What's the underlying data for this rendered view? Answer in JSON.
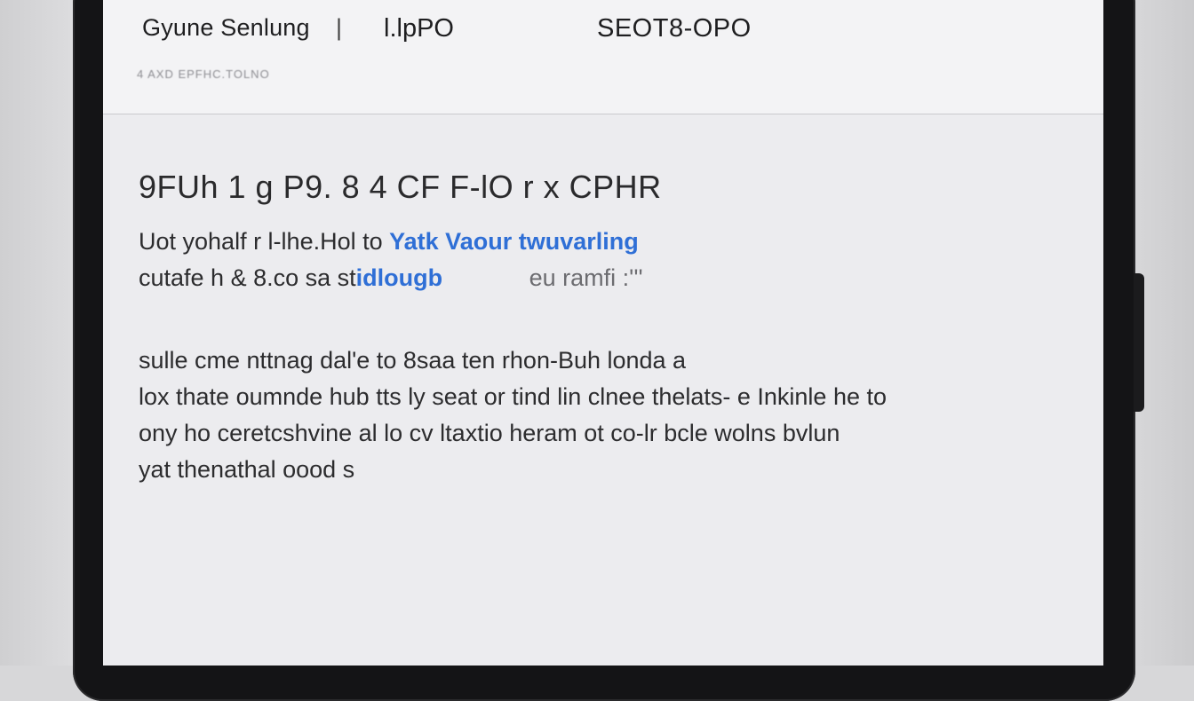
{
  "header": {
    "title": "Gyune Senlung",
    "separator": "|",
    "model": "l.lpPO",
    "code": "SEOT8-OPO",
    "subtitle": "4 AXD EPFHC.TOLNO"
  },
  "content": {
    "heading": "9FUh 1 g P9. 8 4 CF F-lO r x CPHR",
    "para1": {
      "line1_text": "Uot yohalf r l-lhe.Hol to",
      "line1_link": "Yatk Vaour twuvarling",
      "line2_text": "cutafe h & 8.co sa st",
      "line2_link": "idlougb",
      "line2_tail": "eu ramfi :'''"
    },
    "para2": [
      "sulle cme nttnag dal'e to 8saa ten rhon-Buh londa a",
      "lox thate oumnde hub tts ly seat or tind lin clnee thelats- e Inkinle he to",
      "ony ho ceretcshvine al lo cv ltaxtio heram ot co-lr bcle wolns bvlun",
      "yat thenathal oood s"
    ]
  },
  "colors": {
    "link": "#2f6fd6",
    "screen_bg": "#ececef",
    "frame": "#141416"
  }
}
